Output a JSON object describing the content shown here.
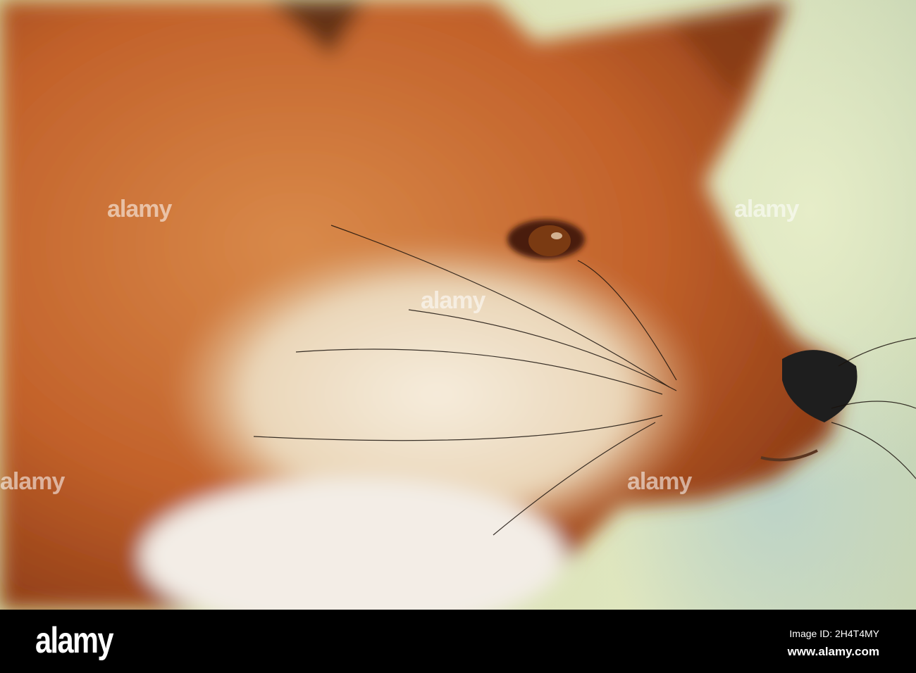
{
  "photo": {
    "subject": "red-fox-head-profile"
  },
  "watermark": {
    "text": "alamy"
  },
  "footer": {
    "logo": "alamy",
    "image_id": "Image ID: 2H4T4MY",
    "url": "www.alamy.com"
  },
  "colors": {
    "fur": "#c7642a",
    "cream": "#f1e3cc",
    "background": "#dfe6bf",
    "nose": "#1e1e1e"
  }
}
